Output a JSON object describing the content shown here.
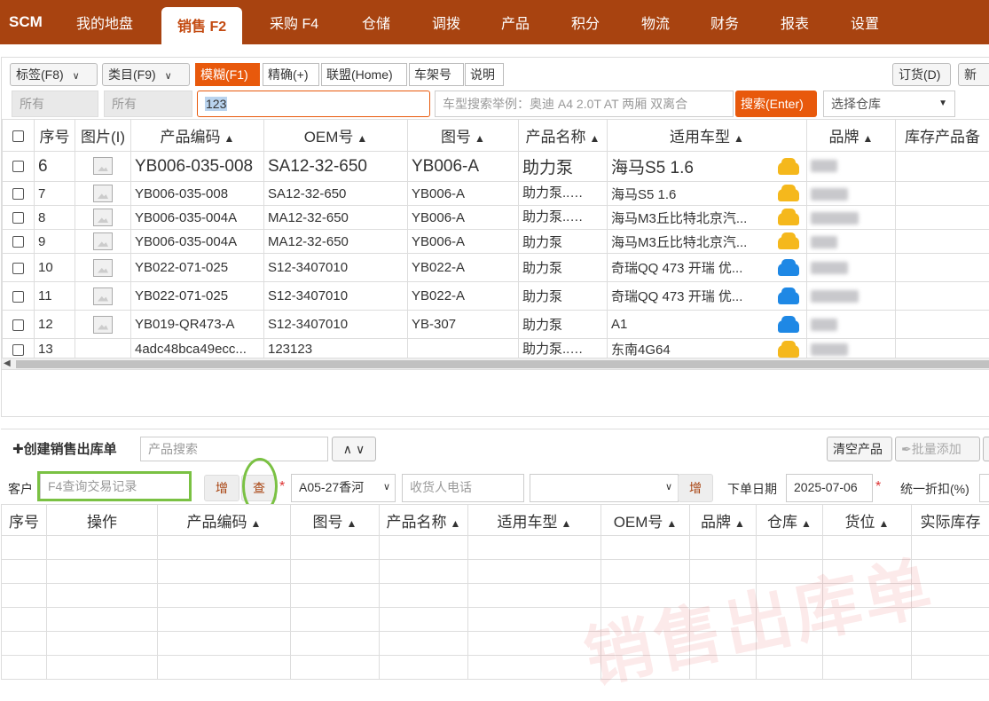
{
  "nav": {
    "logo": "SCM",
    "tabs": [
      "我的地盘",
      "销售 F2",
      "采购 F4",
      "仓储",
      "调拨",
      "产品",
      "积分",
      "物流",
      "财务",
      "报表",
      "设置"
    ],
    "active_tab": "销售 F2"
  },
  "toolbar": {
    "tag_select": "标签(F8)",
    "category_select": "类目(F9)",
    "modes": [
      "模糊(F1)",
      "精确(+)",
      "联盟(Home)",
      "车架号",
      "说明"
    ],
    "active_mode": "模糊(F1)",
    "order_button": "订货(D)",
    "new_button": "新",
    "filter1": "所有",
    "filter2": "所有",
    "search_value": "123",
    "car_search_placeholder": "车型搜索举例：奥迪 A4 2.0T AT 两厢 双离合",
    "search_button": "搜索(Enter)",
    "warehouse_placeholder": "选择仓库"
  },
  "product_table": {
    "headers": [
      "序号",
      "图片(I)",
      "产品编码",
      "OEM号",
      "图号",
      "产品名称",
      "适用车型",
      "品牌",
      "库存产品备"
    ],
    "rows": [
      {
        "no": "6",
        "code": "YB006-035-008",
        "oem": "SA12-32-650",
        "fig": "YB006-A",
        "name": "助力泵",
        "model": "海马S5 1.6",
        "car": "yellow",
        "img": true,
        "tag": false
      },
      {
        "no": "7",
        "code": "YB006-035-008",
        "oem": "SA12-32-650",
        "fig": "YB006-A",
        "name": "助力泵..",
        "model": "海马S5 1.6",
        "car": "yellow",
        "img": true,
        "tag": true
      },
      {
        "no": "8",
        "code": "YB006-035-004A",
        "oem": "MA12-32-650",
        "fig": "YB006-A",
        "name": "助力泵..",
        "model": "海马M3丘比特北京汽...",
        "car": "yellow",
        "img": true,
        "tag": true
      },
      {
        "no": "9",
        "code": "YB006-035-004A",
        "oem": "MA12-32-650",
        "fig": "YB006-A",
        "name": "助力泵",
        "model": "海马M3丘比特北京汽...",
        "car": "yellow",
        "img": true,
        "tag": false
      },
      {
        "no": "10",
        "code": "YB022-071-025",
        "oem": "S12-3407010",
        "fig": "YB022-A",
        "name": "助力泵",
        "model": "奇瑞QQ 473 开瑞 优...",
        "car": "blue",
        "img": true,
        "tag": false
      },
      {
        "no": "11",
        "code": "YB022-071-025",
        "oem": "S12-3407010",
        "fig": "YB022-A",
        "name": "助力泵",
        "model": "奇瑞QQ 473 开瑞 优...",
        "car": "blue",
        "img": true,
        "tag": false
      },
      {
        "no": "12",
        "code": "YB019-QR473-A",
        "oem": "S12-3407010",
        "fig": "YB-307",
        "name": "助力泵",
        "model": "A1",
        "car": "blue",
        "img": true,
        "tag": false
      },
      {
        "no": "13",
        "code": "4adc48bca49ecc...",
        "oem": "123123",
        "fig": "",
        "name": "助力泵..",
        "model": "东南4G64",
        "car": "yellow",
        "img": false,
        "tag": true
      }
    ]
  },
  "order_section": {
    "title": "创建销售出库单",
    "product_search_placeholder": "产品搜索",
    "clear_button": "清空产品",
    "batch_add_button": "批量添加",
    "customer_label": "客户",
    "customer_placeholder": "F4查询交易记录",
    "add_button": "增",
    "lookup_button": "查",
    "location_value": "A05-27香河",
    "receiver_phone_placeholder": "收货人电话",
    "add_button2": "增",
    "order_date_label": "下单日期",
    "order_date": "2025-07-06",
    "discount_label": "统一折扣(%)",
    "headers": [
      "序号",
      "操作",
      "产品编码",
      "图号",
      "产品名称",
      "适用车型",
      "OEM号",
      "品牌",
      "仓库",
      "货位",
      "实际库存"
    ],
    "watermark": "销售出库单"
  }
}
